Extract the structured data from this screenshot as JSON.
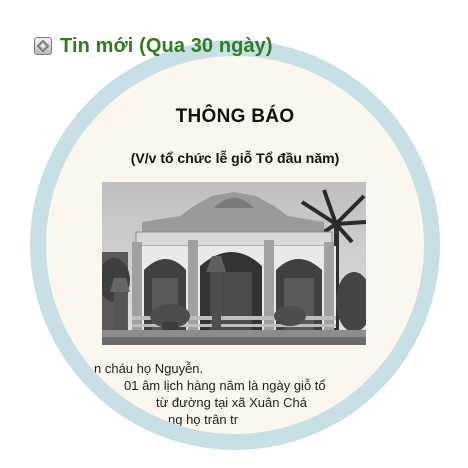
{
  "header": {
    "icon": "bullet-icon",
    "title": "Tin mới (Qua 30 ngày)"
  },
  "notice": {
    "title": "THÔNG BÁO",
    "subtitle": "(V/v tổ chức lễ giỗ Tổ đầu năm)",
    "photo": "ancestral-temple-photo",
    "body_lines": [
      "n cháu họ Nguyễn.",
      "01 âm lịch hàng năm là ngày giỗ tổ",
      "từ đường tại xã Xuân Chá",
      "ng họ trân tr"
    ]
  },
  "colors": {
    "title_green": "#2e7d1e",
    "ring": "#c6e0e6",
    "paper": "#fbf7ee"
  }
}
